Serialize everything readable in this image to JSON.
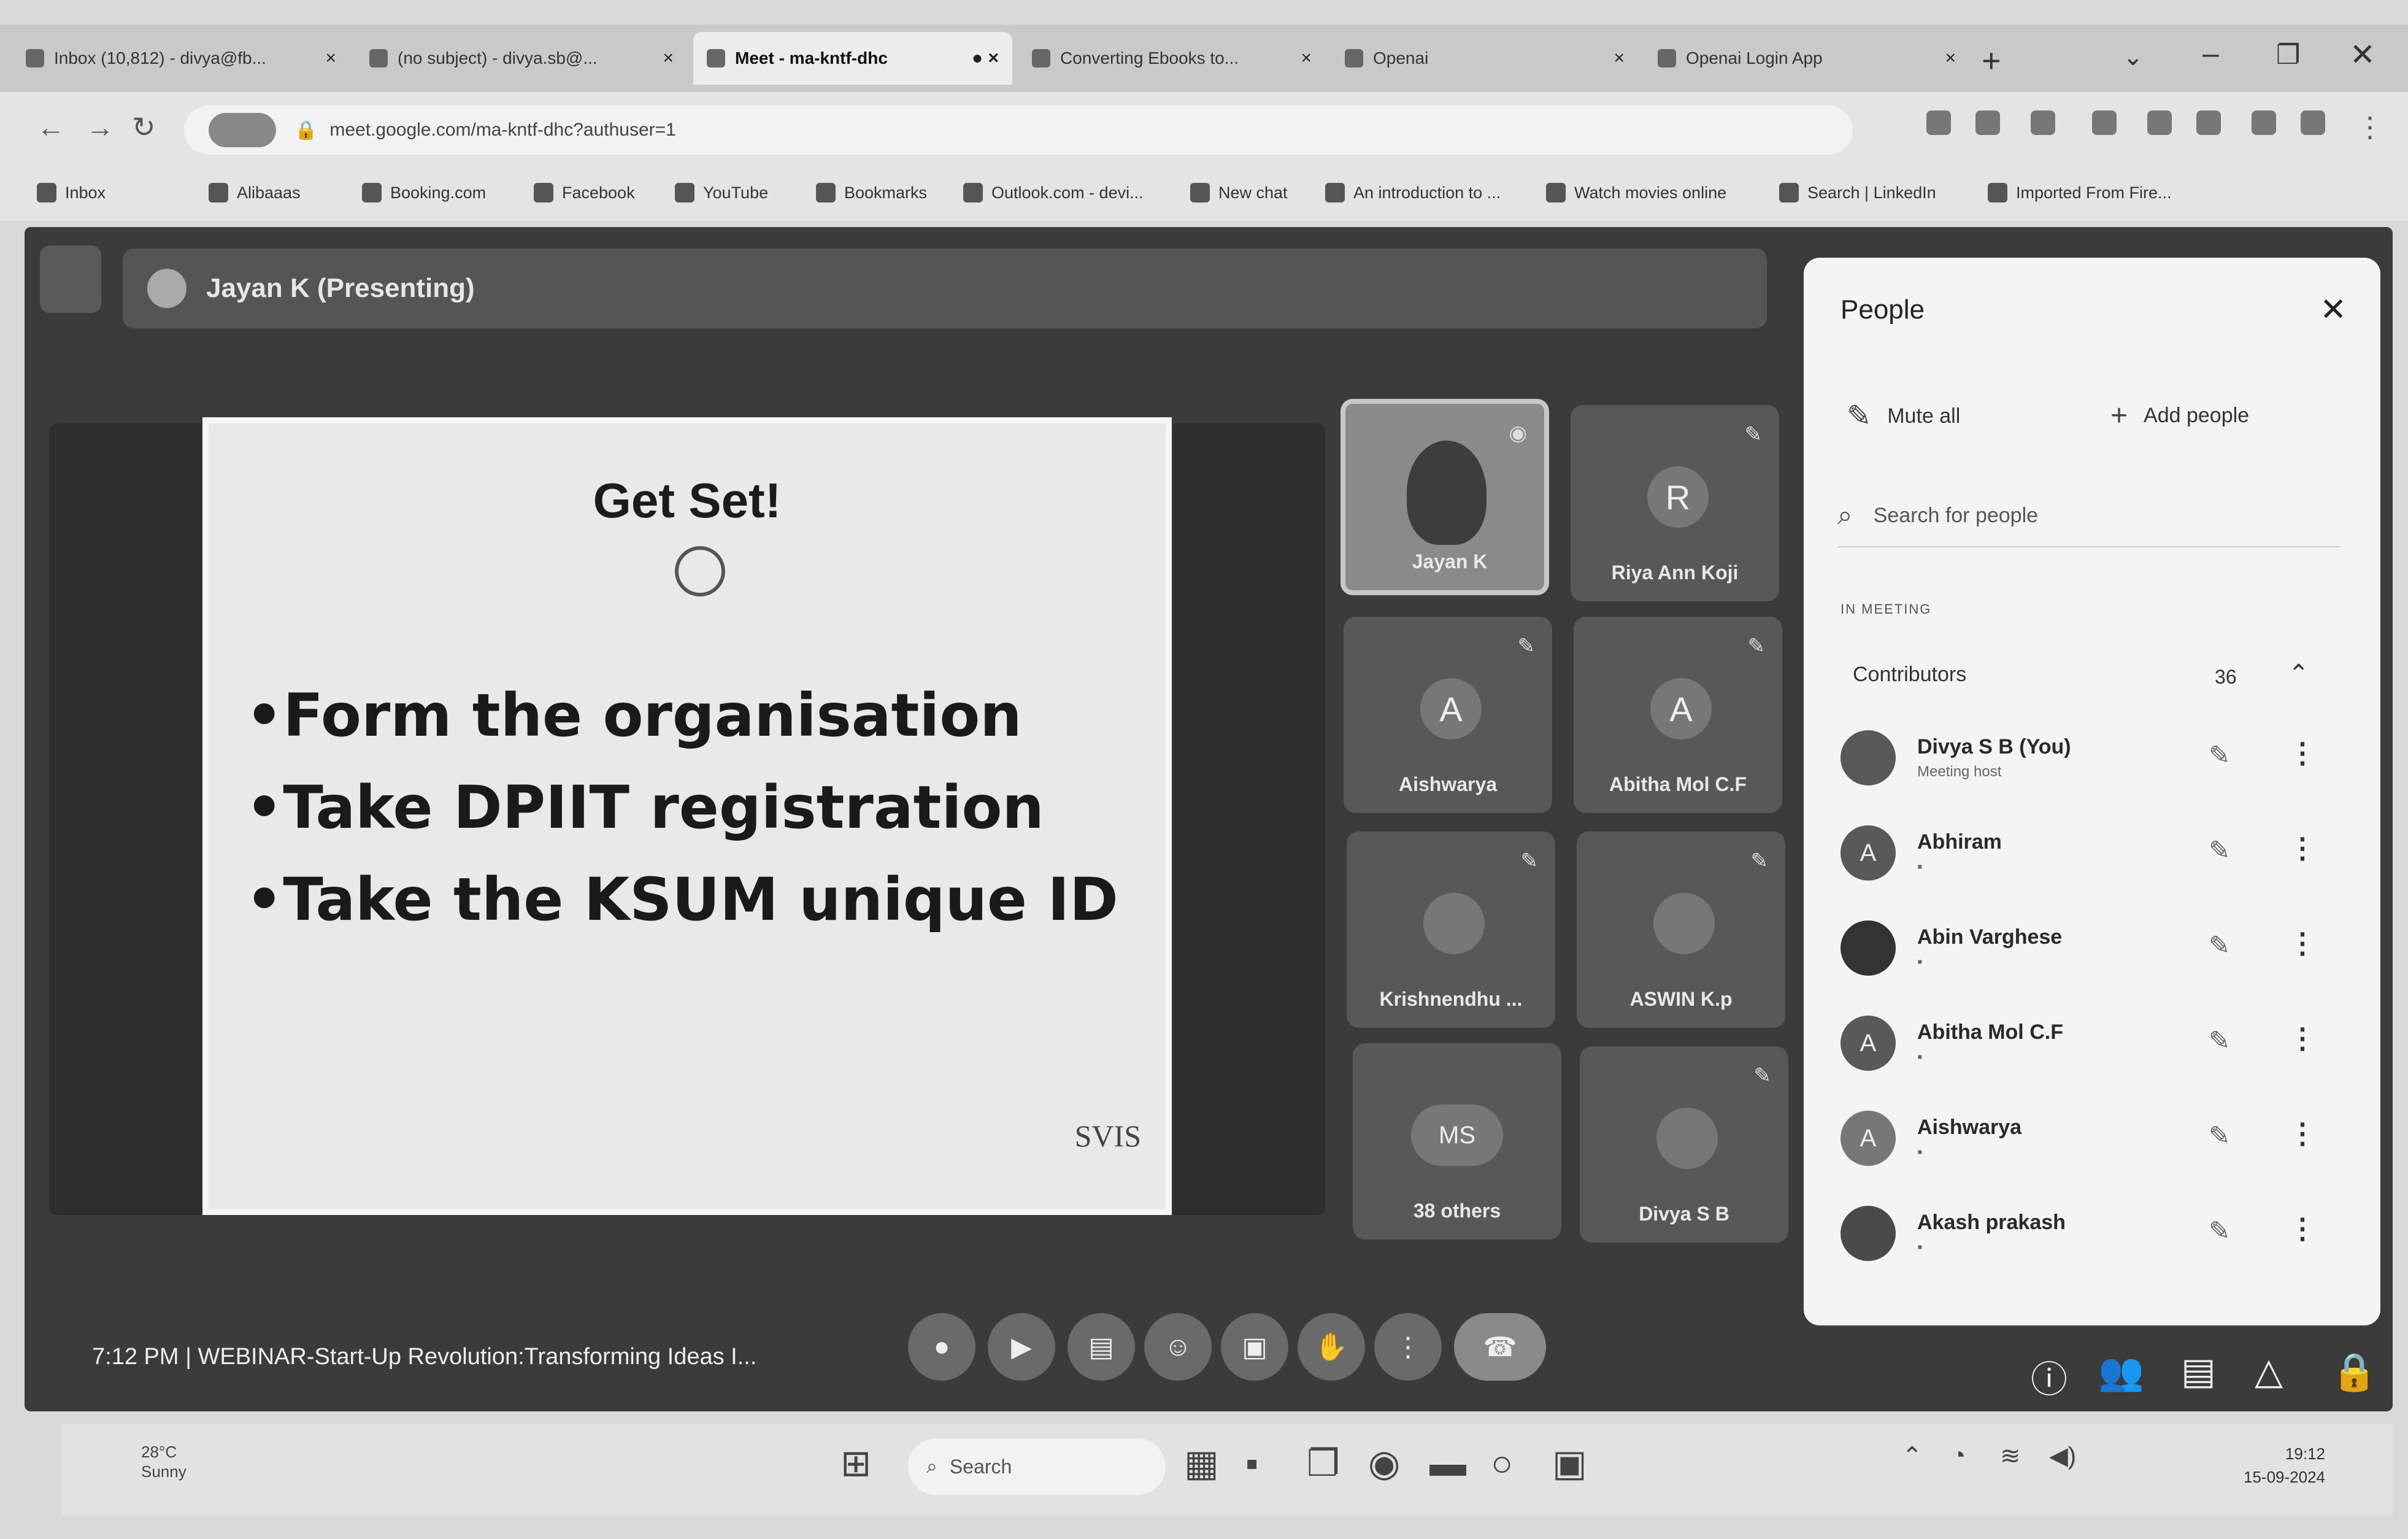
{
  "browser": {
    "tabs": [
      {
        "label": "Inbox (10,812) - divya@fb..."
      },
      {
        "label": "(no subject) - divya.sb@..."
      },
      {
        "label": "Meet - ma-kntf-dhc"
      },
      {
        "label": "Converting Ebooks to..."
      },
      {
        "label": "Openai"
      },
      {
        "label": "Openai Login App"
      }
    ],
    "url": "meet.google.com/ma-kntf-dhc?authuser=1",
    "bookmarks": [
      "Inbox",
      "Alibaaas",
      "Booking.com",
      "Facebook",
      "YouTube",
      "Bookmarks",
      "Outlook.com - devi...",
      "New chat",
      "An introduction to ...",
      "Watch movies online",
      "Search | LinkedIn",
      "Imported From Fire..."
    ]
  },
  "meet": {
    "presenter": "Jayan K (Presenting)",
    "slide": {
      "title": "Get Set!",
      "bullets": [
        "•Form the organisation",
        "•Take DPIIT registration",
        "•Take the KSUM unique ID"
      ],
      "logo": "SVIS"
    },
    "tiles": [
      {
        "name": "Jayan K",
        "avatar": ""
      },
      {
        "name": "Riya Ann Koji",
        "avatar": "R"
      },
      {
        "name": "Aishwarya",
        "avatar": "A"
      },
      {
        "name": "Abitha Mol C.F",
        "avatar": "A"
      },
      {
        "name": "Krishnendhu ...",
        "avatar": ""
      },
      {
        "name": "ASWIN K.p",
        "avatar": ""
      },
      {
        "name": "38 others",
        "avatar": "MS"
      },
      {
        "name": "Divya S B",
        "avatar": ""
      }
    ],
    "info": "7:12 PM | WEBINAR-Start-Up Revolution:Transforming Ideas I..."
  },
  "people_panel": {
    "title": "People",
    "mute_all": "Mute all",
    "add_people": "Add people",
    "search_placeholder": "Search for people",
    "section_label": "IN MEETING",
    "group_label": "Contributors",
    "group_count": "36",
    "participants": [
      {
        "name": "Divya S B (You)",
        "sub": "Meeting host",
        "initial": ""
      },
      {
        "name": "Abhiram",
        "sub": "",
        "initial": "A"
      },
      {
        "name": "Abin Varghese",
        "sub": "",
        "initial": ""
      },
      {
        "name": "Abitha Mol C.F",
        "sub": "",
        "initial": "A"
      },
      {
        "name": "Aishwarya",
        "sub": "",
        "initial": "A"
      },
      {
        "name": "Akash prakash",
        "sub": "",
        "initial": ""
      }
    ]
  },
  "taskbar": {
    "weather_temp": "28°C",
    "weather_text": "Sunny",
    "search": "Search",
    "time": "19:12",
    "date": "15-09-2024"
  }
}
